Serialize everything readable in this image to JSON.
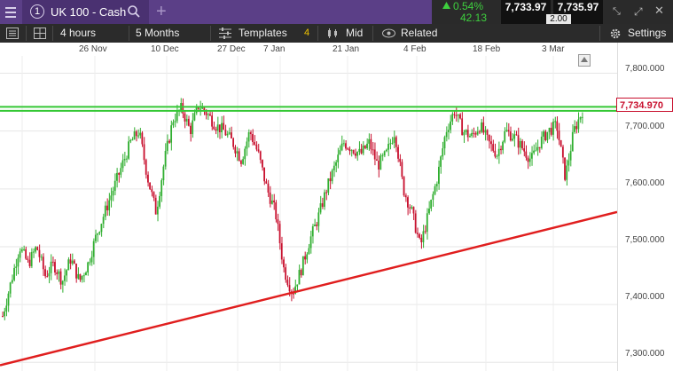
{
  "header": {
    "instrument_number": "1",
    "instrument_name": "UK 100 - Cash",
    "add_tab_label": "+",
    "change_percent": "0.54%",
    "change_points": "42.13",
    "bid": "7,733.97",
    "ask": "7,735.97",
    "spread": "2.00",
    "window_controls": [
      "collapse-icon",
      "expand-icon",
      "close-icon"
    ]
  },
  "toolbar": {
    "timeframe": "4 hours",
    "range": "5 Months",
    "templates_label": "Templates",
    "templates_count": "4",
    "price_type": "Mid",
    "related_label": "Related",
    "settings_label": "Settings"
  },
  "chart": {
    "date_labels": [
      "26 Nov",
      "10 Dec",
      "27 Dec",
      "7 Jan",
      "21 Jan",
      "4 Feb",
      "18 Feb",
      "3 Mar"
    ],
    "price_labels": [
      "7,800.000",
      "7,700.000",
      "7,600.000",
      "7,500.000",
      "7,400.000",
      "7,300.000"
    ],
    "current_price": "7,734.970",
    "colors": {
      "up": "#2fae2f",
      "down": "#c8102e",
      "trendline": "#e01e1e",
      "hline": "#35c835",
      "accent": "#5b3f87"
    }
  },
  "chart_data": {
    "type": "candlestick",
    "x_labels": [
      "26 Nov",
      "10 Dec",
      "27 Dec",
      "7 Jan",
      "21 Jan",
      "4 Feb",
      "18 Feb",
      "3 Mar"
    ],
    "ylim": [
      7285,
      7830
    ],
    "yticks": [
      7800,
      7700,
      7600,
      7500,
      7400,
      7300
    ],
    "series": [
      {
        "name": "price",
        "close_path": [
          7380,
          7440,
          7500,
          7470,
          7500,
          7450,
          7470,
          7440,
          7480,
          7440,
          7470,
          7520,
          7560,
          7600,
          7640,
          7680,
          7700,
          7620,
          7560,
          7650,
          7720,
          7740,
          7700,
          7745,
          7730,
          7710,
          7700,
          7680,
          7650,
          7700,
          7660,
          7600,
          7560,
          7460,
          7420,
          7460,
          7510,
          7550,
          7600,
          7640,
          7680,
          7670,
          7660,
          7680,
          7640,
          7660,
          7700,
          7600,
          7560,
          7500,
          7560,
          7620,
          7700,
          7735,
          7700,
          7690,
          7710,
          7680,
          7660,
          7700,
          7690,
          7670,
          7650,
          7680,
          7700,
          7710,
          7620,
          7700,
          7735
        ]
      }
    ],
    "horizontal_lines": [
      7742,
      7735
    ],
    "trendline": {
      "from": [
        "start",
        7295
      ],
      "to": [
        "end",
        7560
      ]
    }
  }
}
